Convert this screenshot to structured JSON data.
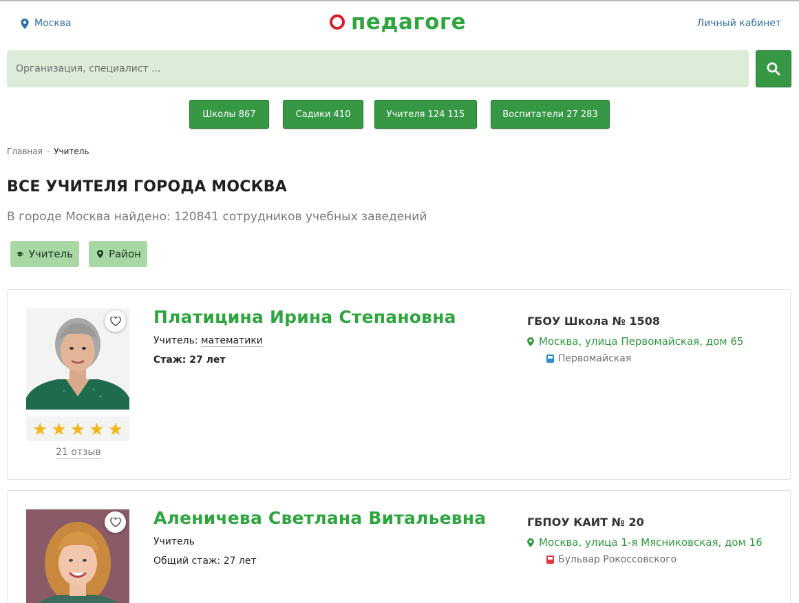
{
  "header": {
    "city": "Москва",
    "logo_text": "педагоге",
    "account": "Личный кабинет"
  },
  "search": {
    "placeholder": "Организация, специалист ..."
  },
  "categories": [
    {
      "label": "Школы 867"
    },
    {
      "label": "Садики 410"
    },
    {
      "label": "Учителя 124 115"
    },
    {
      "label": "Воспитатели 27 283"
    }
  ],
  "breadcrumb": {
    "home": "Главная",
    "separator": "-",
    "current": "Учитель"
  },
  "page": {
    "title": "ВСЕ УЧИТЕЛЯ ГОРОДА МОСКВА",
    "found": "В городе Москва найдено: 120841 сотрудников учебных заведений"
  },
  "filters": [
    {
      "label": "Учитель",
      "icon": "graduation-cap-icon"
    },
    {
      "label": "Район",
      "icon": "map-pin-icon"
    }
  ],
  "teachers": [
    {
      "name": "Платицина Ирина Степановна",
      "role_prefix": "Учитель: ",
      "subject": "математики",
      "experience": "Стаж: 27 лет",
      "rating": 5,
      "reviews": "21 отзыв",
      "org": "ГБОУ Школа № 1508",
      "address": "Москва, улица Первомайская, дом 65",
      "metro": "Первомайская",
      "metro_color": "#2a8fcb"
    },
    {
      "name": "Аленичева Светлана Витальевна",
      "role": "Учитель",
      "experience": "Общий стаж: 27 лет",
      "org": "ГБПОУ КАИТ № 20",
      "address": "Москва, улица 1-я Мясниковская, дом 16",
      "metro": "Бульвар Рокоссовского",
      "metro_color": "#e03a3e"
    }
  ],
  "colors": {
    "brand_green": "#2fa53f",
    "button_green": "#369845",
    "logo_red": "#d81e2b",
    "link_blue": "#2f6fa3",
    "search_bg": "#ddecd9",
    "filter_bg": "#a8d8a3",
    "star": "#f4b616"
  }
}
